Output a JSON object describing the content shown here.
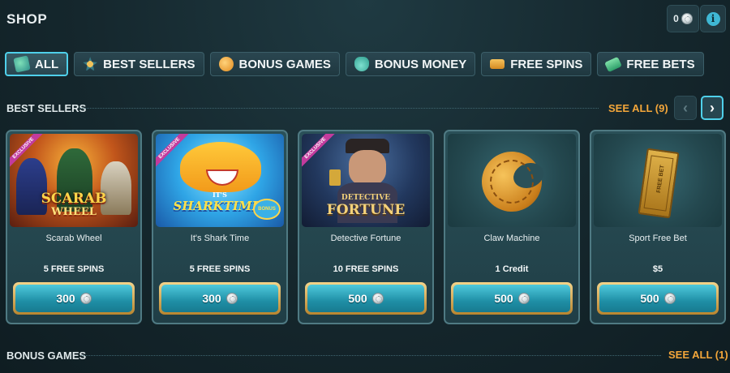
{
  "header": {
    "title": "SHOP",
    "balance": "0"
  },
  "tabs": [
    {
      "label": "ALL",
      "icon": "gem-cards-icon",
      "active": true
    },
    {
      "label": "BEST SELLERS",
      "icon": "star-badge-icon"
    },
    {
      "label": "BONUS GAMES",
      "icon": "bonus-games-icon"
    },
    {
      "label": "BONUS MONEY",
      "icon": "money-bag-icon"
    },
    {
      "label": "FREE SPINS",
      "icon": "ticket-icon"
    },
    {
      "label": "FREE BETS",
      "icon": "bet-ticket-icon"
    }
  ],
  "sections": {
    "best_sellers": {
      "title": "BEST SELLERS",
      "see_all": "SEE ALL (9)"
    },
    "bonus_games": {
      "title": "BONUS GAMES",
      "see_all": "SEE ALL (1)"
    }
  },
  "cards": [
    {
      "name": "Scarab Wheel",
      "reward": "5 FREE SPINS",
      "price": "300",
      "badge": "EXCLUSIVE",
      "art_text": [
        "SCARAB",
        "WHEEL"
      ]
    },
    {
      "name": "It's Shark Time",
      "reward": "5 FREE SPINS",
      "price": "300",
      "badge": "EXCLUSIVE",
      "art_text": [
        "IT'S",
        "SHARKTIME!",
        "BONUS"
      ]
    },
    {
      "name": "Detective Fortune",
      "reward": "10 FREE SPINS",
      "price": "500",
      "badge": "EXCLUSIVE",
      "art_text": [
        "DETECTIVE",
        "FORTUNE"
      ]
    },
    {
      "name": "Claw Machine",
      "reward": "1 Credit",
      "price": "500"
    },
    {
      "name": "Sport Free Bet",
      "reward": "$5",
      "price": "500",
      "art_text": [
        "FREE BET"
      ]
    }
  ],
  "colors": {
    "accent": "#4fd0ea",
    "see_all": "#f3a63a",
    "button": "#1f8fa6",
    "button_border": "#d9aa55"
  }
}
